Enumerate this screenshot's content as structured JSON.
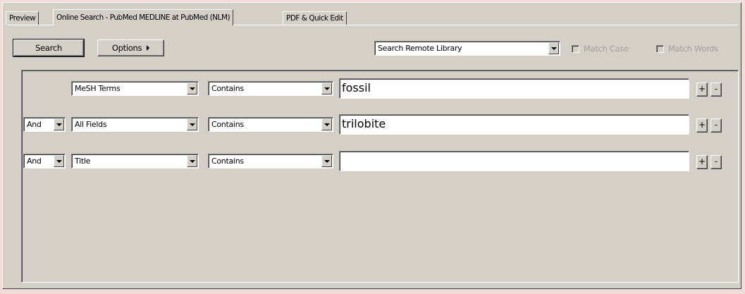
{
  "tabs": [
    {
      "label": "Preview",
      "active": false
    },
    {
      "label": "Online Search - PubMed MEDLINE at PubMed (NLM)",
      "active": true
    },
    {
      "label": "PDF & Quick Edit",
      "active": false
    }
  ],
  "toolbar": {
    "search_label": "Search",
    "options_label": "Options",
    "library_select": "Search Remote Library",
    "match_case_label": "Match Case",
    "match_words_label": "Match Words"
  },
  "rows": [
    {
      "connector": "",
      "field": "MeSH Terms",
      "operator": "Contains",
      "value": "fossil",
      "add": "+",
      "remove": "-"
    },
    {
      "connector": "And",
      "field": "All Fields",
      "operator": "Contains",
      "value": "trilobite",
      "add": "+",
      "remove": "-"
    },
    {
      "connector": "And",
      "field": "Title",
      "operator": "Contains",
      "value": "",
      "add": "+",
      "remove": "-"
    }
  ]
}
